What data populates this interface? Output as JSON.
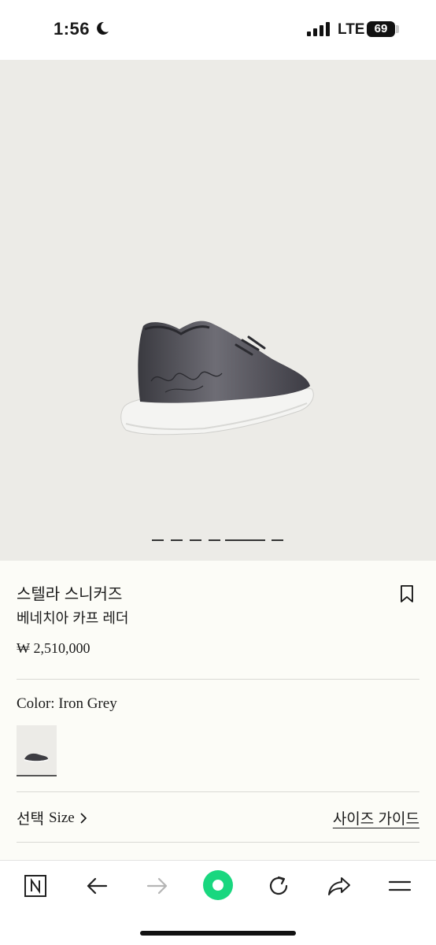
{
  "status_bar": {
    "time": "1:56",
    "network": "LTE",
    "battery": "69"
  },
  "hero": {
    "image_icon": "sneaker-image",
    "carousel_pages": 6,
    "active_page": 5
  },
  "product": {
    "name": "스텔라 스니커즈",
    "subtitle": "베네치아 카프 레더",
    "price": "₩ 2,510,000",
    "color_label": "Color: Iron Grey",
    "size_select_korean": "선택",
    "size_select_english": "Size",
    "size_guide": "사이즈 가이드"
  },
  "toolbar": {
    "icons": [
      "naver-n-icon",
      "back-arrow-icon",
      "forward-arrow-icon",
      "green-circle-icon",
      "refresh-icon",
      "share-icon",
      "menu-icon"
    ]
  },
  "colors": {
    "hero_bg": "#ecebe7",
    "page_bg": "#fcfcf7",
    "accent_green": "#19d77f"
  }
}
